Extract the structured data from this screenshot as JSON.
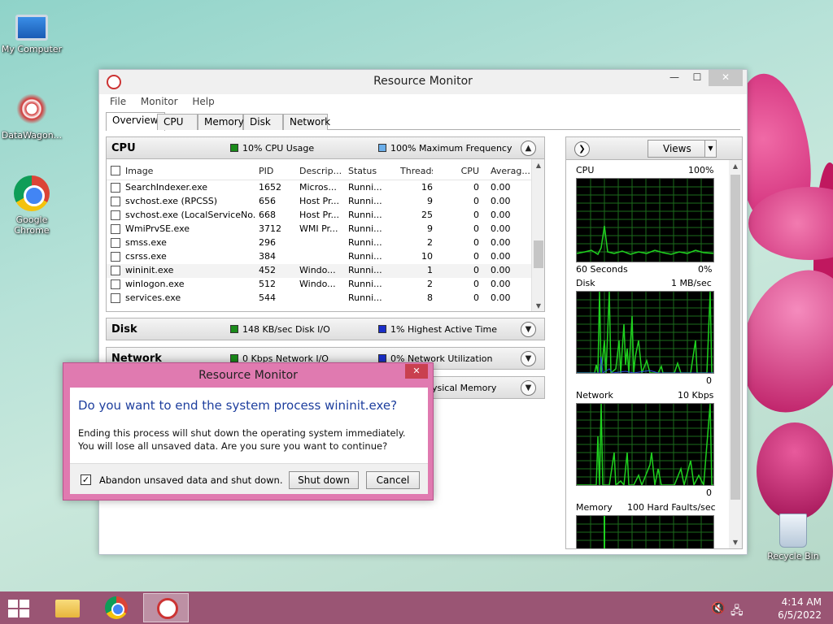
{
  "desktop": {
    "icons": [
      {
        "label": "My Computer"
      },
      {
        "label": "DataWagon..."
      },
      {
        "label": "Google Chrome"
      },
      {
        "label": "Recycle Bin"
      }
    ]
  },
  "window": {
    "title": "Resource Monitor",
    "menu": [
      "File",
      "Monitor",
      "Help"
    ],
    "tabs": [
      "Overview",
      "CPU",
      "Memory",
      "Disk",
      "Network"
    ],
    "active_tab": "Overview"
  },
  "cpu": {
    "title": "CPU",
    "usage": "10% CPU Usage",
    "frequency": "100% Maximum Frequency",
    "columns": [
      "Image",
      "PID",
      "Descrip...",
      "Status",
      "Threads",
      "CPU",
      "Averag..."
    ],
    "rows": [
      {
        "image": "SearchIndexer.exe",
        "pid": "1652",
        "desc": "Micros...",
        "status": "Runni...",
        "threads": "16",
        "cpu": "0",
        "avg": "0.00"
      },
      {
        "image": "svchost.exe (RPCSS)",
        "pid": "656",
        "desc": "Host Pr...",
        "status": "Runni...",
        "threads": "9",
        "cpu": "0",
        "avg": "0.00"
      },
      {
        "image": "svchost.exe (LocalServiceNo...",
        "pid": "668",
        "desc": "Host Pr...",
        "status": "Runni...",
        "threads": "25",
        "cpu": "0",
        "avg": "0.00"
      },
      {
        "image": "WmiPrvSE.exe",
        "pid": "3712",
        "desc": "WMI Pr...",
        "status": "Runni...",
        "threads": "9",
        "cpu": "0",
        "avg": "0.00"
      },
      {
        "image": "smss.exe",
        "pid": "296",
        "desc": "",
        "status": "Runni...",
        "threads": "2",
        "cpu": "0",
        "avg": "0.00"
      },
      {
        "image": "csrss.exe",
        "pid": "384",
        "desc": "",
        "status": "Runni...",
        "threads": "10",
        "cpu": "0",
        "avg": "0.00"
      },
      {
        "image": "wininit.exe",
        "pid": "452",
        "desc": "Windo...",
        "status": "Runni...",
        "threads": "1",
        "cpu": "0",
        "avg": "0.00"
      },
      {
        "image": "winlogon.exe",
        "pid": "512",
        "desc": "Windo...",
        "status": "Runni...",
        "threads": "2",
        "cpu": "0",
        "avg": "0.00"
      },
      {
        "image": "services.exe",
        "pid": "544",
        "desc": "",
        "status": "Runni...",
        "threads": "8",
        "cpu": "0",
        "avg": "0.00"
      }
    ]
  },
  "disk": {
    "title": "Disk",
    "io": "148 KB/sec Disk I/O",
    "active": "1% Highest Active Time"
  },
  "network": {
    "title": "Network",
    "io": "0 Kbps Network I/O",
    "util": "0% Network Utilization"
  },
  "memory": {
    "stat": "hysical Memory"
  },
  "right_panel": {
    "views_label": "Views",
    "cpu": {
      "label": "CPU",
      "max": "100%",
      "time": "60 Seconds",
      "min": "0%"
    },
    "disk": {
      "label": "Disk",
      "max": "1 MB/sec",
      "min": "0"
    },
    "network": {
      "label": "Network",
      "max": "10 Kbps",
      "min": "0"
    },
    "memory": {
      "label": "Memory",
      "max": "100 Hard Faults/sec"
    }
  },
  "dialog": {
    "title": "Resource Monitor",
    "heading": "Do you want to end the system process wininit.exe?",
    "body": "Ending this process will shut down the operating system immediately. You will lose all unsaved data. Are you sure you want to continue?",
    "checkbox_label": "Abandon unsaved data and shut down.",
    "checkbox_checked": true,
    "confirm_label": "Shut down",
    "cancel_label": "Cancel"
  },
  "taskbar": {
    "time": "4:14 AM",
    "date": "6/5/2022"
  },
  "colors": {
    "taskbar": "#9a5574",
    "dialog_frame": "#e07ab0",
    "heading_blue": "#1e3f9e",
    "graph_green": "#1fd11f",
    "graph_bg": "#000000"
  }
}
